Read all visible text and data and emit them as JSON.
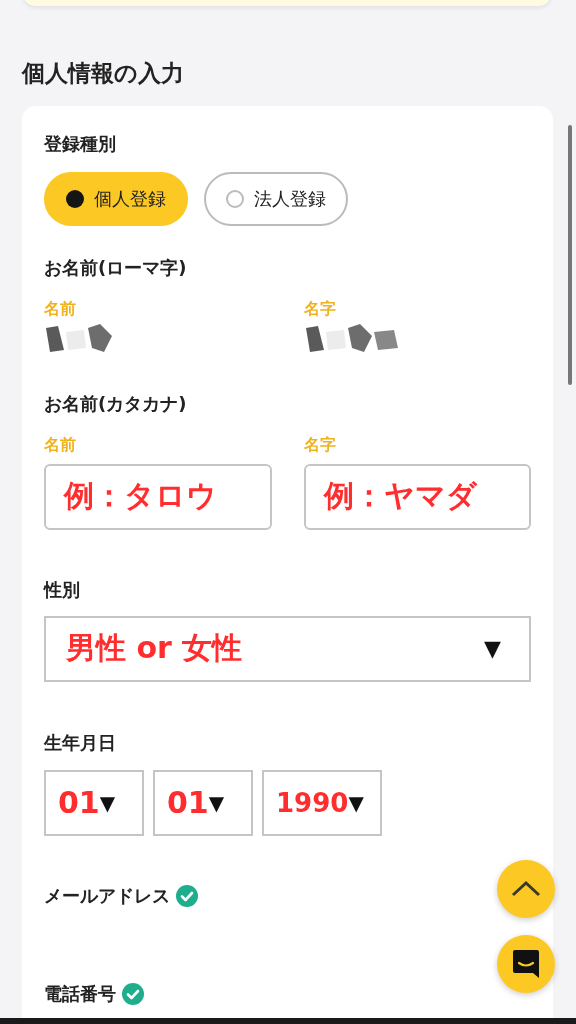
{
  "section_title": "個人情報の入力",
  "registration_type": {
    "label": "登録種別",
    "options": [
      {
        "label": "個人登録",
        "selected": true
      },
      {
        "label": "法人登録",
        "selected": false
      }
    ]
  },
  "name_roman": {
    "label": "お名前(ローマ字)",
    "fields": [
      {
        "label": "名前"
      },
      {
        "label": "名字"
      }
    ]
  },
  "name_katakana": {
    "label": "お名前(カタカナ)",
    "fields": [
      {
        "label": "名前",
        "value": "例：タロウ"
      },
      {
        "label": "名字",
        "value": "例：ヤマダ"
      }
    ]
  },
  "gender": {
    "label": "性別",
    "value": "男性 or 女性",
    "arrow": "▼"
  },
  "birthdate": {
    "label": "生年月日",
    "selects": [
      {
        "value": "01",
        "arrow": "▼"
      },
      {
        "value": "01",
        "arrow": "▼"
      },
      {
        "value": "1990",
        "arrow": "▼"
      }
    ]
  },
  "email": {
    "label": "メールアドレス",
    "verified": true
  },
  "phone": {
    "label": "電話番号",
    "verified": true
  }
}
